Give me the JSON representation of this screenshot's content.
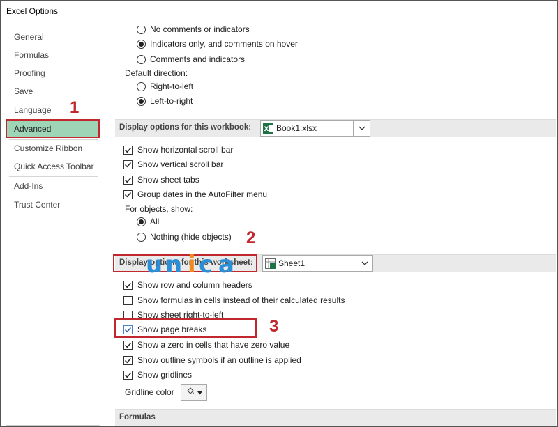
{
  "window": {
    "title": "Excel Options"
  },
  "nav": {
    "items": [
      {
        "label": "General"
      },
      {
        "label": "Formulas"
      },
      {
        "label": "Proofing"
      },
      {
        "label": "Save"
      },
      {
        "label": "Language"
      },
      {
        "label": "Advanced"
      },
      {
        "label": "Customize Ribbon"
      },
      {
        "label": "Quick Access Toolbar"
      },
      {
        "label": "Add-Ins"
      },
      {
        "label": "Trust Center"
      }
    ],
    "active": "Advanced"
  },
  "comments": {
    "options": [
      {
        "label": "No comments or indicators",
        "selected": false
      },
      {
        "label": "Indicators only, and comments on hover",
        "selected": true
      },
      {
        "label": "Comments and indicators",
        "selected": false
      }
    ]
  },
  "direction": {
    "heading": "Default direction:",
    "options": [
      {
        "label": "Right-to-left",
        "selected": false
      },
      {
        "label": "Left-to-right",
        "selected": true
      }
    ]
  },
  "workbook_section": {
    "label": "Display options for this workbook:",
    "selected": "Book1.xlsx",
    "checkboxes": [
      {
        "label": "Show horizontal scroll bar",
        "checked": true
      },
      {
        "label": "Show vertical scroll bar",
        "checked": true
      },
      {
        "label": "Show sheet tabs",
        "checked": true
      },
      {
        "label": "Group dates in the AutoFilter menu",
        "checked": true
      }
    ],
    "objects_heading": "For objects, show:",
    "objects": [
      {
        "label": "All",
        "selected": true
      },
      {
        "label": "Nothing (hide objects)",
        "selected": false
      }
    ]
  },
  "worksheet_section": {
    "label": "Display options for this worksheet:",
    "selected": "Sheet1",
    "checkboxes": [
      {
        "label": "Show row and column headers",
        "checked": true
      },
      {
        "label": "Show formulas in cells instead of their calculated results",
        "checked": false
      },
      {
        "label": "Show sheet right-to-left",
        "checked": false
      },
      {
        "label": "Show page breaks",
        "checked": true
      },
      {
        "label": "Show a zero in cells that have zero value",
        "checked": true
      },
      {
        "label": "Show outline symbols if an outline is applied",
        "checked": true
      },
      {
        "label": "Show gridlines",
        "checked": true
      }
    ],
    "gridline_label": "Gridline color"
  },
  "formulas_section": {
    "label": "Formulas"
  },
  "callouts": [
    "1",
    "2",
    "3"
  ],
  "watermark": {
    "text": "unica"
  },
  "colors": {
    "accent_red": "#c0282d",
    "nav_active": "#9fd5b7",
    "excel_green": "#1e7145"
  }
}
